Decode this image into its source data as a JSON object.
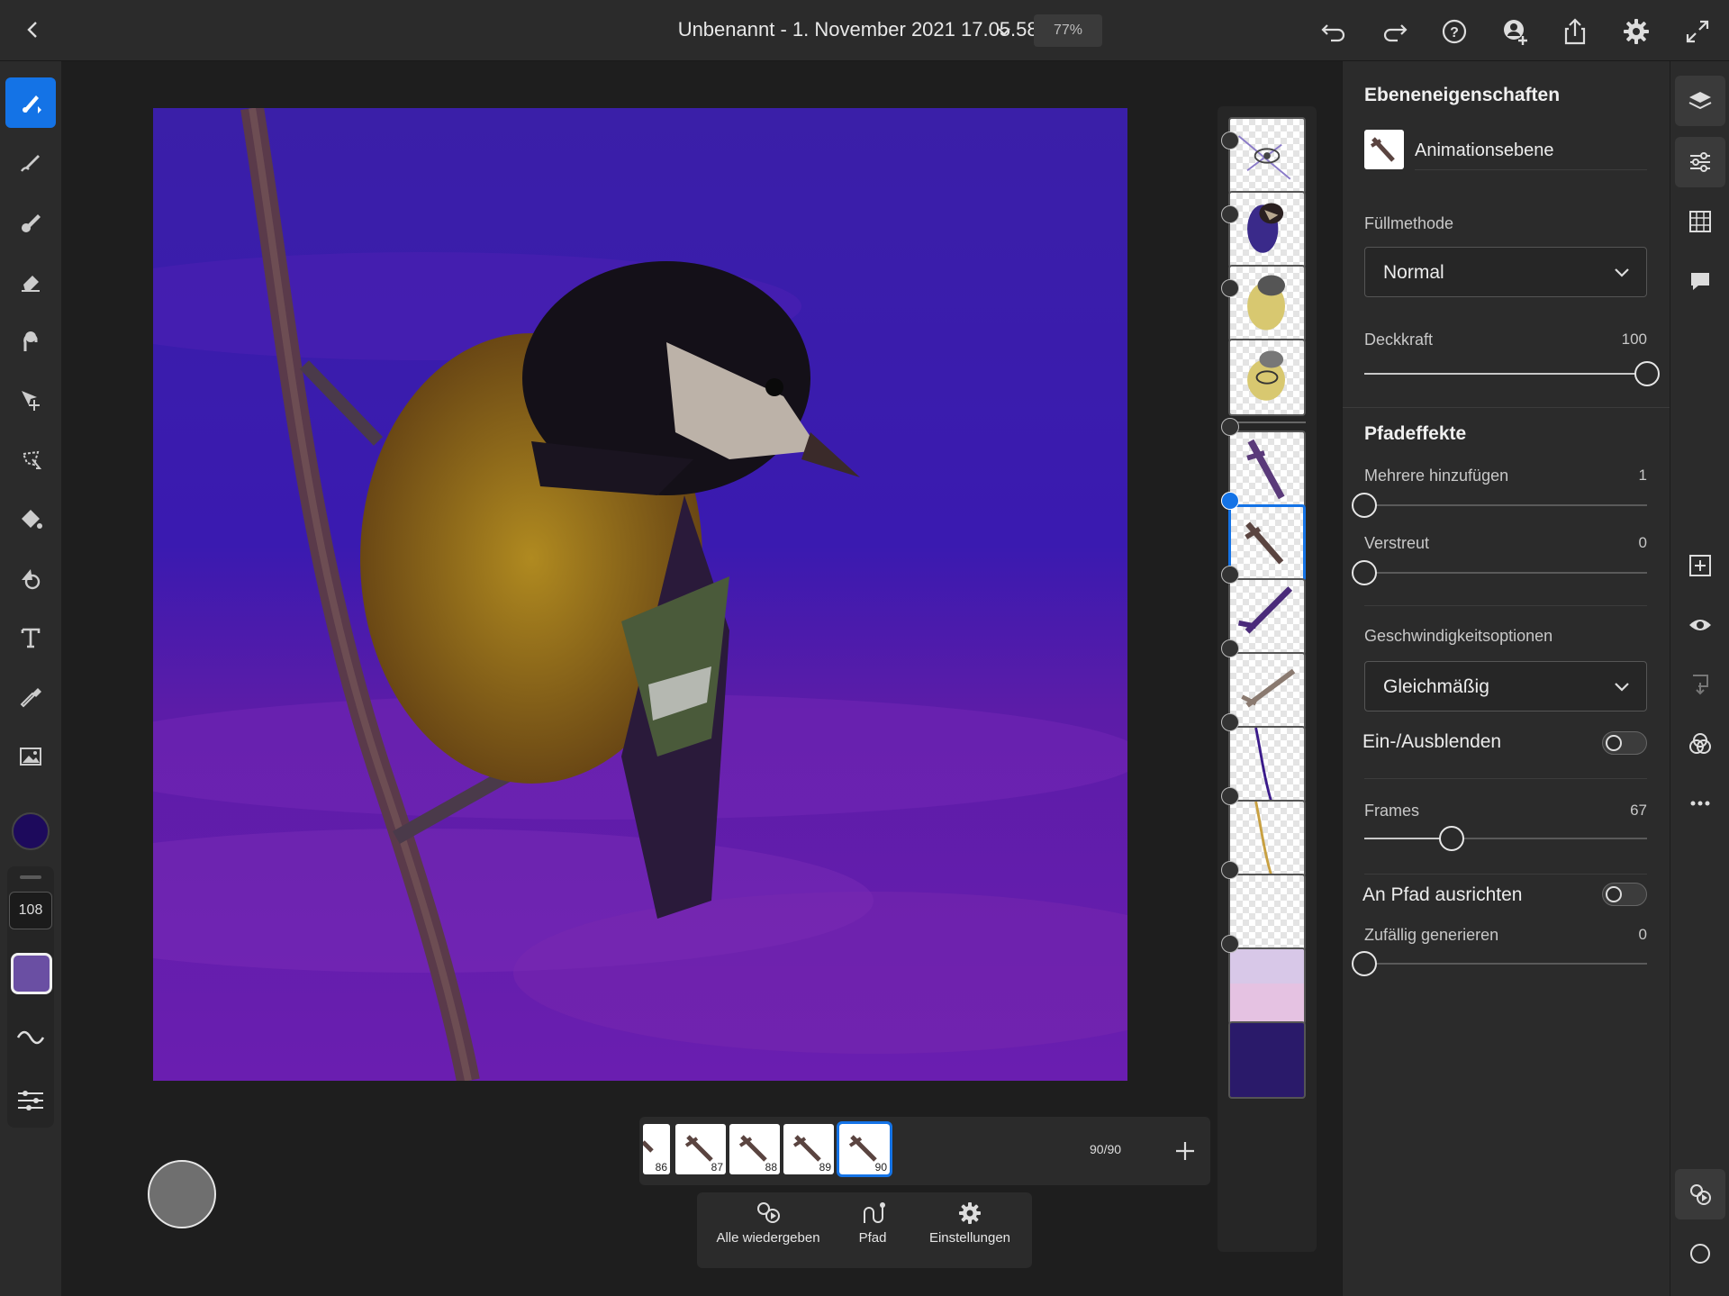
{
  "header": {
    "title": "Unbenannt - 1. November 2021 17.05.58 *",
    "zoom": "77%",
    "icons": [
      "back-icon",
      "undo-icon",
      "redo-icon",
      "help-icon",
      "invite-icon",
      "share-icon",
      "settings-icon",
      "fullscreen-icon"
    ]
  },
  "tools": [
    "paint-brush-tool",
    "smudge-tool",
    "mixer-tool",
    "eraser-tool",
    "liquify-tool",
    "transform-tool",
    "lasso-tool",
    "fill-tool",
    "shape-tool",
    "text-tool",
    "eyedropper-tool",
    "image-tool"
  ],
  "colors": {
    "primary": "#1d0a5c",
    "brush": "#6a4fa3",
    "accent": "#1473e6"
  },
  "brush": {
    "size": "108"
  },
  "timeline": {
    "frames": [
      {
        "label": "86"
      },
      {
        "label": "87"
      },
      {
        "label": "88"
      },
      {
        "label": "89"
      },
      {
        "label": "90",
        "selected": true
      }
    ],
    "counter": "90/90"
  },
  "animation_bar": {
    "play_all": "Alle wiedergeben",
    "path": "Pfad",
    "settings": "Einstellungen"
  },
  "panel": {
    "title": "Ebeneneigenschaften",
    "layer_name": "Animationsebene",
    "blend_label": "Füllmethode",
    "blend_value": "Normal",
    "opacity_label": "Deckkraft",
    "opacity_value": "100",
    "path_effects_title": "Pfadeffekte",
    "multiple_label": "Mehrere hinzufügen",
    "multiple_value": "1",
    "scatter_label": "Verstreut",
    "scatter_value": "0",
    "speed_label": "Geschwindigkeitsoptionen",
    "speed_value": "Gleichmäßig",
    "fade_label": "Ein-/Ausblenden",
    "frames_label": "Frames",
    "frames_value": "67",
    "align_label": "An Pfad ausrichten",
    "random_label": "Zufällig generieren",
    "random_value": "0"
  },
  "levels": {
    "opacity": 1.0,
    "multiple": 0.0,
    "scatter": 0.0,
    "frames": 0.31,
    "random": 0.0
  },
  "rail_icons": [
    "layers-icon",
    "layer-properties-icon",
    "grid-icon",
    "comments-icon",
    "add-layer-icon",
    "visibility-icon",
    "merge-icon",
    "blend-icon",
    "more-icon",
    "animation-icon",
    "circle-icon"
  ]
}
